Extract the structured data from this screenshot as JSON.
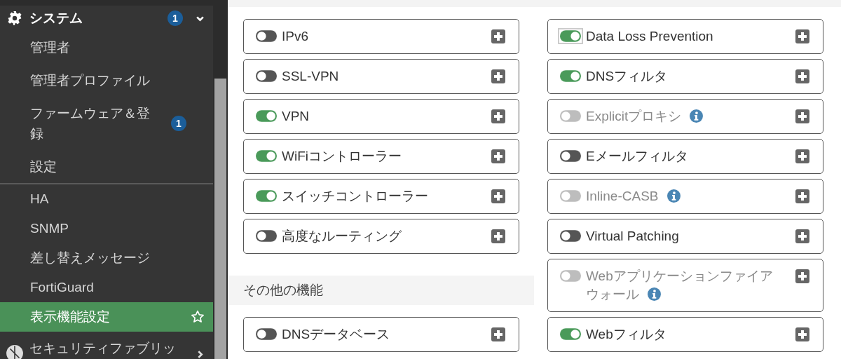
{
  "sidebar": {
    "header": {
      "label": "システム",
      "badge": "1",
      "expanded": true
    },
    "sections": [
      {
        "items": [
          {
            "label": "管理者",
            "selected": false
          },
          {
            "label": "管理者プロファイル",
            "selected": false
          },
          {
            "label": "ファームウェア＆登録",
            "badge": "1",
            "selected": false
          },
          {
            "label": "設定",
            "selected": false
          }
        ]
      },
      {
        "items": [
          {
            "label": "HA",
            "selected": false
          },
          {
            "label": "SNMP",
            "selected": false
          },
          {
            "label": "差し替えメッセージ",
            "selected": false
          },
          {
            "label": "FortiGuard",
            "selected": false
          },
          {
            "label": "表示機能設定",
            "selected": true
          }
        ]
      }
    ],
    "next_group": {
      "label": "セキュリティファブリッ",
      "expanded": false
    }
  },
  "left_column": {
    "features": [
      {
        "label": "IPv6",
        "on": false,
        "disabled": false,
        "info": false,
        "focused": false
      },
      {
        "label": "SSL-VPN",
        "on": false,
        "disabled": false,
        "info": false,
        "focused": false
      },
      {
        "label": "VPN",
        "on": true,
        "disabled": false,
        "info": false,
        "focused": false
      },
      {
        "label": "WiFiコントローラー",
        "on": true,
        "disabled": false,
        "info": false,
        "focused": false
      },
      {
        "label": "スイッチコントローラー",
        "on": true,
        "disabled": false,
        "info": false,
        "focused": false
      },
      {
        "label": "高度なルーティング",
        "on": false,
        "disabled": false,
        "info": false,
        "focused": false
      }
    ],
    "other_section": {
      "title": "その他の機能",
      "features": [
        {
          "label": "DNSデータベース",
          "on": false,
          "disabled": false,
          "info": false,
          "focused": false
        }
      ]
    }
  },
  "right_column": {
    "features": [
      {
        "label": "Data Loss Prevention",
        "on": true,
        "disabled": false,
        "info": false,
        "focused": true
      },
      {
        "label": "DNSフィルタ",
        "on": true,
        "disabled": false,
        "info": false,
        "focused": false
      },
      {
        "label": "Explicitプロキシ",
        "on": false,
        "disabled": true,
        "info": true,
        "focused": false
      },
      {
        "label": "Eメールフィルタ",
        "on": false,
        "disabled": false,
        "info": false,
        "focused": false
      },
      {
        "label": "Inline-CASB",
        "on": false,
        "disabled": true,
        "info": true,
        "focused": false
      },
      {
        "label": "Virtual Patching",
        "on": false,
        "disabled": false,
        "info": false,
        "focused": false
      },
      {
        "label": "Webアプリケーションファイアウォール",
        "on": false,
        "disabled": true,
        "info": true,
        "focused": false
      },
      {
        "label": "Webフィルタ",
        "on": true,
        "disabled": false,
        "info": false,
        "focused": false
      }
    ]
  }
}
